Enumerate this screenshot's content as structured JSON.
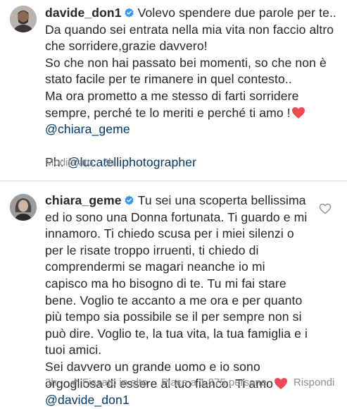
{
  "comment1": {
    "username": "davide_don1",
    "lines": [
      "Volevo spendere due parole per te..",
      "Da quando sei entrata nella mia vita non faccio altro",
      "che sorridere,grazie davvero!",
      "So che non hai passato bei momenti, so che non è",
      "stato facile per te rimanere in quel contesto..",
      "Ma ora prometto a me stesso di farti sorridere",
      "sempre, perché te lo meriti e perché ti amo !"
    ],
    "mention": "@chiara_geme",
    "credit_prefix": "Ph: ",
    "credit_mention": "@lucatelliphotographer",
    "meta_edited": "Modificato",
    "meta_dot": "·",
    "meta_time": "3h"
  },
  "comment2": {
    "username": "chiara_geme",
    "lines": [
      "Tu sei una scoperta bellissima",
      "ed io sono una Donna fortunata. Ti guardo e mi",
      "innamoro. Ti chiedo scusa per i miei silenzi o",
      "per le risate troppo irruenti, ti chiedo di",
      "comprendermi se magari neanche io mi",
      "capisco ma ho bisogno di te. Tu mi fai stare",
      "bene. Voglio te accanto a me ora e per quanto",
      "più tempo sia possibile se il per sempre non si",
      "può dire. Voglio te, la tua vita, la tua famiglia e i",
      "tuoi amici.",
      "Sei davvero un grande uomo e io sono",
      "orgogliosa di essere al tuo fianco. Ti amo"
    ],
    "mention": "@davide_don1",
    "meta_time": "3h",
    "pinned_label": "Fissato in alto",
    "likes_label": "Piace a 1.875 persone",
    "reply_label": "Rispondi"
  },
  "icons": {
    "verified": "verified-badge-icon",
    "heart": "red-heart-emoji",
    "like": "heart-outline-icon",
    "pin": "pushpin-icon"
  },
  "colors": {
    "text": "#262626",
    "mention": "#00376b",
    "meta": "#8e8e8e",
    "verified": "#3897f0",
    "heart": "#ed4956",
    "divider": "#dbdbdb"
  }
}
